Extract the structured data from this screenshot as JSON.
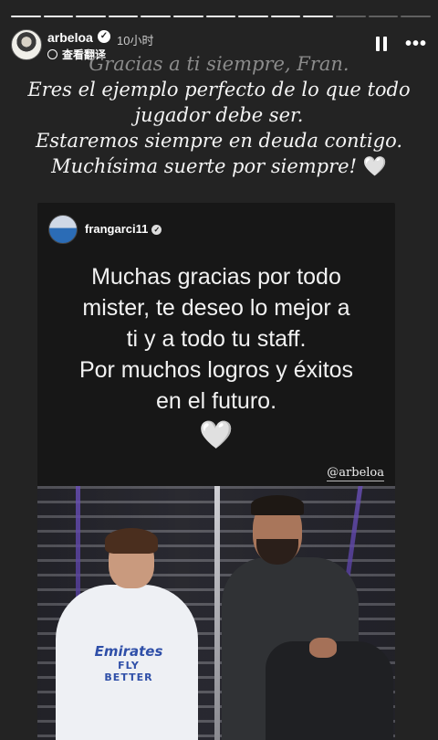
{
  "progress": {
    "total": 13,
    "completed": 10,
    "current": 11
  },
  "header": {
    "username": "arbeloa",
    "verified_mark": "✓",
    "time": "10小时",
    "translate_label": "查看翻译",
    "more_label": "•••",
    "icons": {
      "avatar": "profile-avatar",
      "verified": "verified-badge",
      "translate": "globe-icon",
      "pause": "pause-icon",
      "more": "more-icon"
    }
  },
  "caption": {
    "lines": [
      "Gracias a ti siempre, Fran.",
      "Eres el ejemplo perfecto de lo que todo",
      "jugador debe ser.",
      "Estaremos siempre en deuda contigo.",
      "Muchísima suerte por siempre!"
    ],
    "heart": "🤍"
  },
  "shared_post": {
    "username": "frangarci11",
    "verified_mark": "✓",
    "text_lines": [
      "Muchas gracias por todo",
      "mister, te deseo lo mejor a",
      "ti y a todo tu staff.",
      "Por muchos logros y éxitos",
      "en el futuro."
    ],
    "heart": "🤍",
    "mention": "@arbeloa",
    "photo": {
      "sponsor_line1": "Emirates",
      "sponsor_line2": "FLY BETTER"
    }
  },
  "colors": {
    "background": "#232323",
    "card_background": "#171717",
    "sponsor_blue": "#2f4fa8"
  }
}
